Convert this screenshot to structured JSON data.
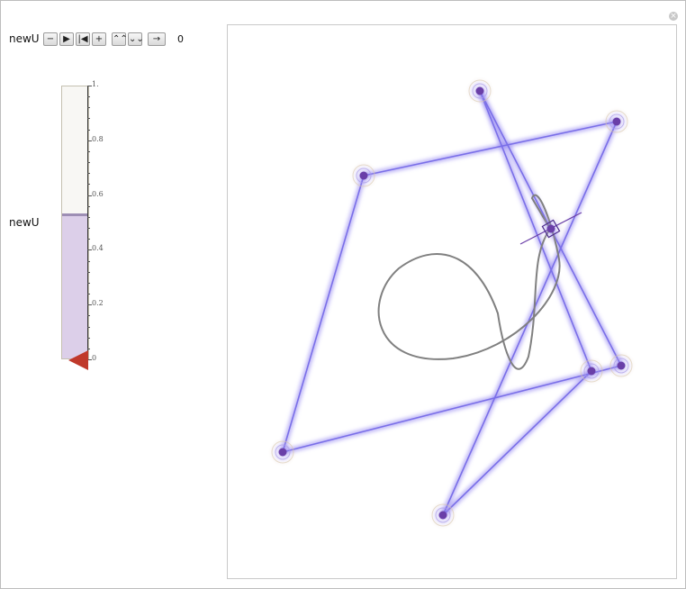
{
  "controls": {
    "param_label": "newU",
    "slider_label": "newU",
    "value": "0",
    "buttons": [
      "−",
      "▶",
      "|◀",
      "+",
      "⌃⌃",
      "⌄⌄",
      "→"
    ],
    "slider_value": 0.52,
    "slider_ticks": [
      "0",
      "0.2",
      "0.4",
      "0.6",
      "0.8",
      "1."
    ]
  },
  "colors": {
    "accent": "#7b68ee",
    "point": "#6a3fa8",
    "curve": "#808080",
    "slider_fill": "#dccfe9",
    "thumb": "#c0392b"
  },
  "icons": {
    "close": "close-icon"
  }
}
